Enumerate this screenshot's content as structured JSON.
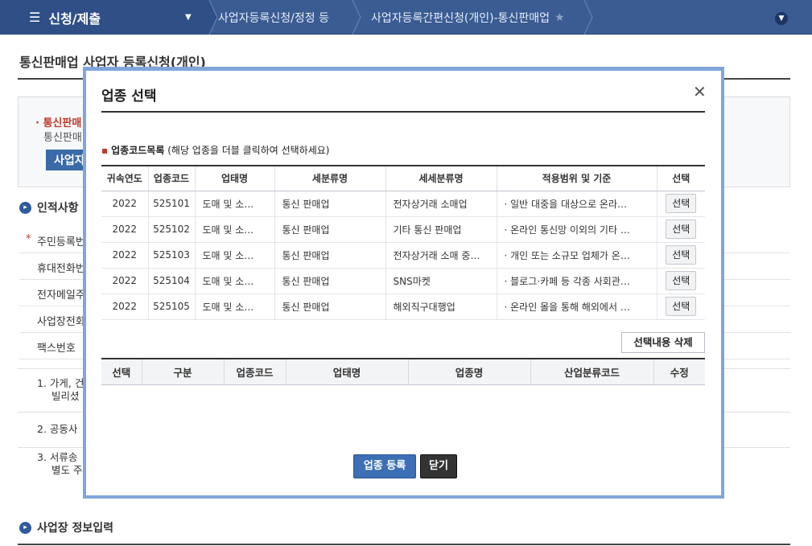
{
  "nav": {
    "menu_title": "신청/제출",
    "crumb1": "사업자등록신청/정정 등",
    "crumb2": "사업자등록간편신청(개인)-통신판매업"
  },
  "page": {
    "title": "통신판매업 사업자 등록신청(개인)",
    "notice_red": "통신판매",
    "notice_gray": "통신판매",
    "notice_button": "사업자",
    "section_personal": "인적사항",
    "fields": [
      "주민등록번",
      "휴대전화번",
      "전자메일주",
      "사업장전화",
      "팩스번호"
    ],
    "list": [
      "1. 가게, 건",
      "빌리셨",
      "2. 공동사",
      "3. 서류송",
      "별도 주"
    ],
    "section_business": "사업장 정보입력"
  },
  "modal": {
    "title": "업종 선택",
    "section_label": "업종코드목록",
    "section_hint": "(해당 업종을 더블 클릭하여 선택하세요)",
    "columns": [
      "귀속연도",
      "업종코드",
      "업태명",
      "세분류명",
      "세세분류명",
      "적용범위 및 기준",
      "선택"
    ],
    "rows": [
      {
        "year": "2022",
        "code": "525101",
        "type": "도매 및 소…",
        "sub": "통신 판매업",
        "subsub": "전자상거래 소매업",
        "scope": "· 일반 대중을 대상으로 온라…",
        "select": "선택"
      },
      {
        "year": "2022",
        "code": "525102",
        "type": "도매 및 소…",
        "sub": "통신 판매업",
        "subsub": "기타 통신 판매업",
        "scope": "· 온라인 통신망 이외의 기타 …",
        "select": "선택"
      },
      {
        "year": "2022",
        "code": "525103",
        "type": "도매 및 소…",
        "sub": "통신 판매업",
        "subsub": "전자상거래 소매 중…",
        "scope": "· 개인 또는 소규모 업체가 온…",
        "select": "선택"
      },
      {
        "year": "2022",
        "code": "525104",
        "type": "도매 및 소…",
        "sub": "통신 판매업",
        "subsub": "SNS마켓",
        "scope": "· 블로그·카페 등 각종 사회관…",
        "select": "선택"
      },
      {
        "year": "2022",
        "code": "525105",
        "type": "도매 및 소…",
        "sub": "통신 판매업",
        "subsub": "해외직구대행업",
        "scope": "·  온라인 몰을 통해 해외에서 …",
        "select": "선택"
      }
    ],
    "delete_button": "선택내용 삭제",
    "selected_columns": [
      "선택",
      "구분",
      "업종코드",
      "업태명",
      "업종명",
      "산업분류코드",
      "수정"
    ],
    "register_button": "업종 등록",
    "close_button": "닫기"
  }
}
